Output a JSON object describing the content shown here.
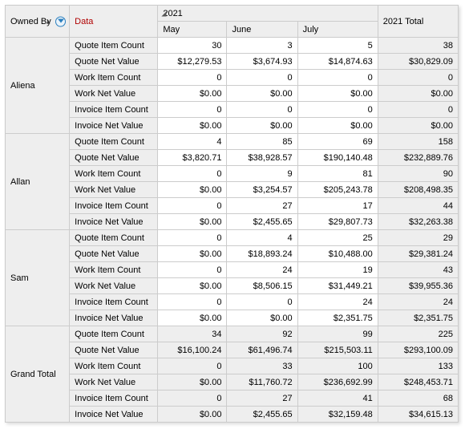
{
  "headers": {
    "owned_by": "Owned By",
    "data": "Data",
    "year": "2021",
    "year_total": "2021 Total",
    "months": [
      "May",
      "June",
      "July"
    ]
  },
  "metrics": [
    "Quote Item Count",
    "Quote Net Value",
    "Work Item Count",
    "Work Net Value",
    "Invoice Item Count",
    "Invoice Net Value"
  ],
  "rows": [
    {
      "owner": "Aliena",
      "values": [
        [
          "30",
          "3",
          "5",
          "38"
        ],
        [
          "$12,279.53",
          "$3,674.93",
          "$14,874.63",
          "$30,829.09"
        ],
        [
          "0",
          "0",
          "0",
          "0"
        ],
        [
          "$0.00",
          "$0.00",
          "$0.00",
          "$0.00"
        ],
        [
          "0",
          "0",
          "0",
          "0"
        ],
        [
          "$0.00",
          "$0.00",
          "$0.00",
          "$0.00"
        ]
      ]
    },
    {
      "owner": "Allan",
      "values": [
        [
          "4",
          "85",
          "69",
          "158"
        ],
        [
          "$3,820.71",
          "$38,928.57",
          "$190,140.48",
          "$232,889.76"
        ],
        [
          "0",
          "9",
          "81",
          "90"
        ],
        [
          "$0.00",
          "$3,254.57",
          "$205,243.78",
          "$208,498.35"
        ],
        [
          "0",
          "27",
          "17",
          "44"
        ],
        [
          "$0.00",
          "$2,455.65",
          "$29,807.73",
          "$32,263.38"
        ]
      ]
    },
    {
      "owner": "Sam",
      "values": [
        [
          "0",
          "4",
          "25",
          "29"
        ],
        [
          "$0.00",
          "$18,893.24",
          "$10,488.00",
          "$29,381.24"
        ],
        [
          "0",
          "24",
          "19",
          "43"
        ],
        [
          "$0.00",
          "$8,506.15",
          "$31,449.21",
          "$39,955.36"
        ],
        [
          "0",
          "0",
          "24",
          "24"
        ],
        [
          "$0.00",
          "$0.00",
          "$2,351.75",
          "$2,351.75"
        ]
      ]
    },
    {
      "owner": "Grand Total",
      "grand": true,
      "values": [
        [
          "34",
          "92",
          "99",
          "225"
        ],
        [
          "$16,100.24",
          "$61,496.74",
          "$215,503.11",
          "$293,100.09"
        ],
        [
          "0",
          "33",
          "100",
          "133"
        ],
        [
          "$0.00",
          "$11,760.72",
          "$236,692.99",
          "$248,453.71"
        ],
        [
          "0",
          "27",
          "41",
          "68"
        ],
        [
          "$0.00",
          "$2,455.65",
          "$32,159.48",
          "$34,615.13"
        ]
      ]
    }
  ]
}
